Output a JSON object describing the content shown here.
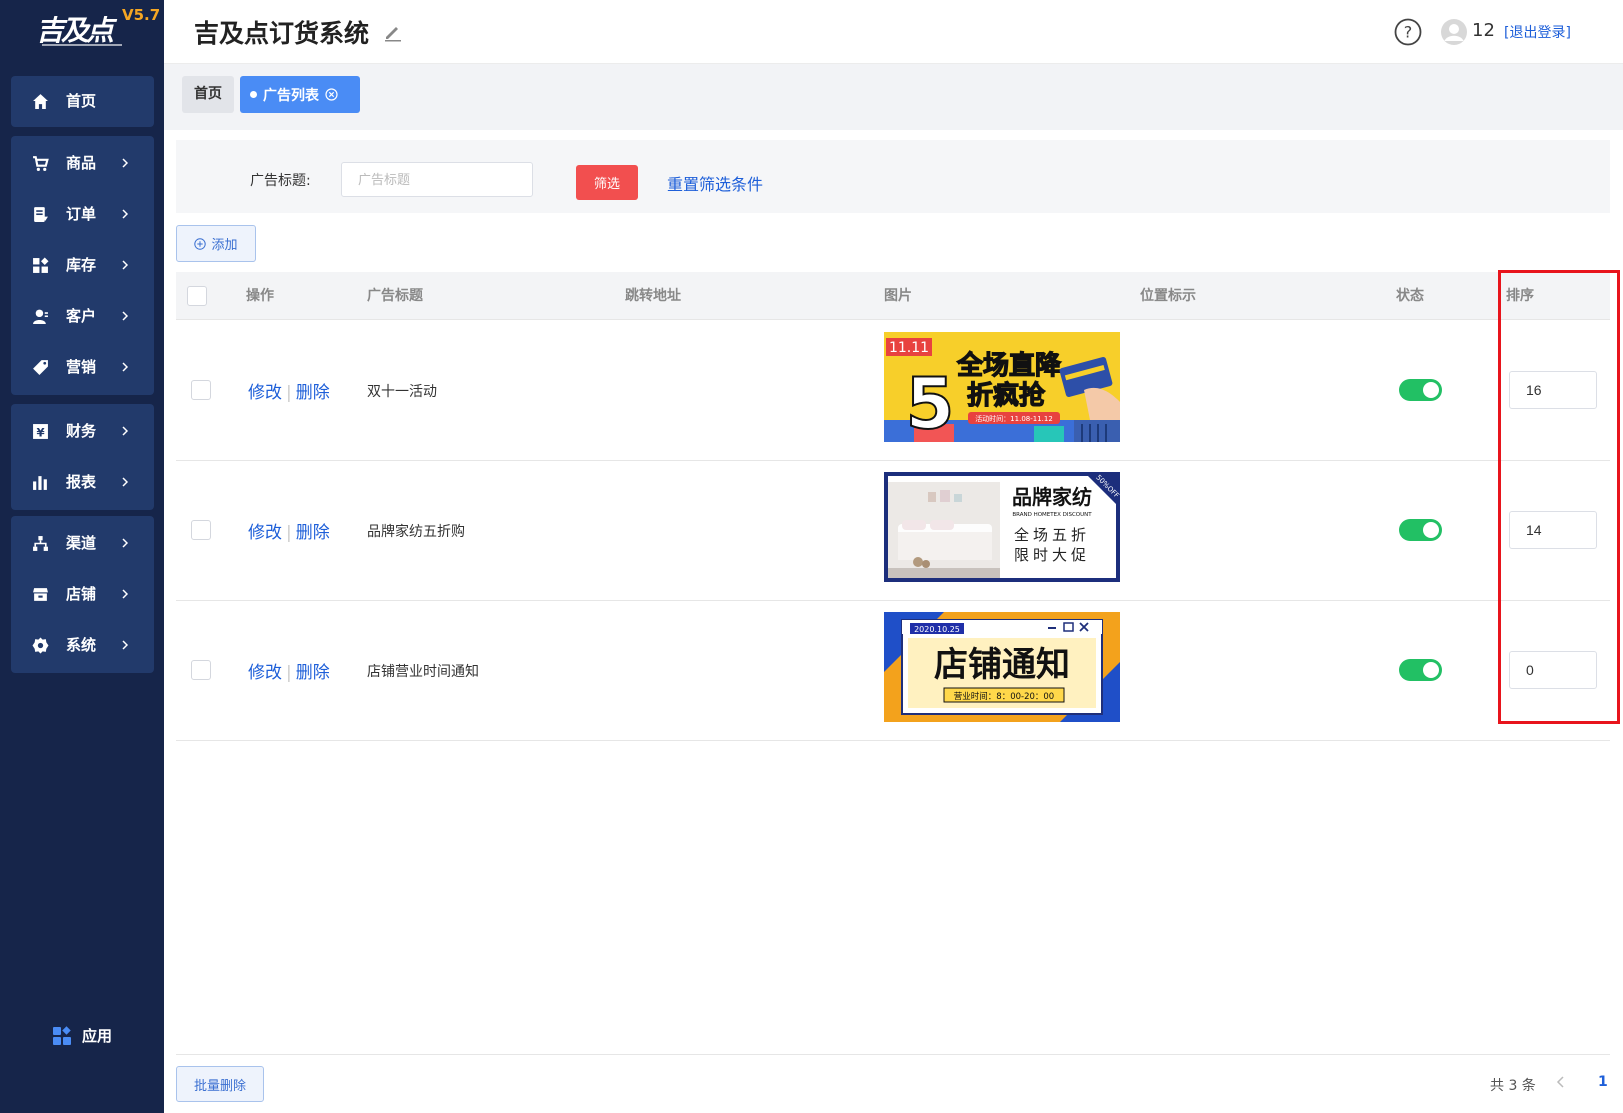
{
  "logo": {
    "text": "吉及点",
    "version": "V5.7"
  },
  "sidebar": {
    "items": [
      {
        "label": "首页",
        "icon": "home-icon"
      },
      {
        "label": "商品",
        "icon": "cart-icon"
      },
      {
        "label": "订单",
        "icon": "order-icon"
      },
      {
        "label": "库存",
        "icon": "inventory-icon"
      },
      {
        "label": "客户",
        "icon": "customer-icon"
      },
      {
        "label": "营销",
        "icon": "tag-icon"
      },
      {
        "label": "财务",
        "icon": "finance-icon"
      },
      {
        "label": "报表",
        "icon": "report-icon"
      },
      {
        "label": "渠道",
        "icon": "channel-icon"
      },
      {
        "label": "店铺",
        "icon": "store-icon"
      },
      {
        "label": "系统",
        "icon": "settings-icon"
      }
    ],
    "apps_label": "应用"
  },
  "header": {
    "title": "吉及点订货系统",
    "user": "12",
    "logout": "[退出登录]"
  },
  "tabs": {
    "home": "首页",
    "active": "广告列表"
  },
  "filter": {
    "label": "广告标题:",
    "placeholder": "广告标题",
    "button": "筛选",
    "reset": "重置筛选条件"
  },
  "add_button": "添加",
  "table": {
    "columns": [
      "操作",
      "广告标题",
      "跳转地址",
      "图片",
      "位置标示",
      "状态",
      "排序"
    ],
    "edit_label": "修改",
    "delete_label": "删除",
    "rows": [
      {
        "title": "双十一活动",
        "url": "",
        "position": "",
        "enabled": true,
        "sort": "16",
        "banner": {
          "tag": "11.11",
          "big_num": "5",
          "line1": "全场直降",
          "line2": "折疯抢",
          "sub": "活动时间：11.08-11.12"
        }
      },
      {
        "title": "品牌家纺五折购",
        "url": "",
        "position": "",
        "enabled": true,
        "sort": "14",
        "banner": {
          "corner": "50%OFF",
          "head": "品牌家纺",
          "en": "BRAND HOMETEX DISCOUNT",
          "line1": "全场五折",
          "line2": "限时大促"
        }
      },
      {
        "title": "店铺营业时间通知",
        "url": "",
        "position": "",
        "enabled": true,
        "sort": "0",
        "banner": {
          "date": "2020.10.25",
          "head": "店铺通知",
          "sub": "营业时间：8：00-20：00"
        }
      }
    ]
  },
  "footer": {
    "batch_delete": "批量删除",
    "total": "共 3 条",
    "page": "1"
  },
  "colors": {
    "sidebar": "#16254a",
    "accent": "#4a8cf5",
    "danger": "#f24f4f",
    "switch_on": "#22c064",
    "highlight": "#e8141c"
  }
}
